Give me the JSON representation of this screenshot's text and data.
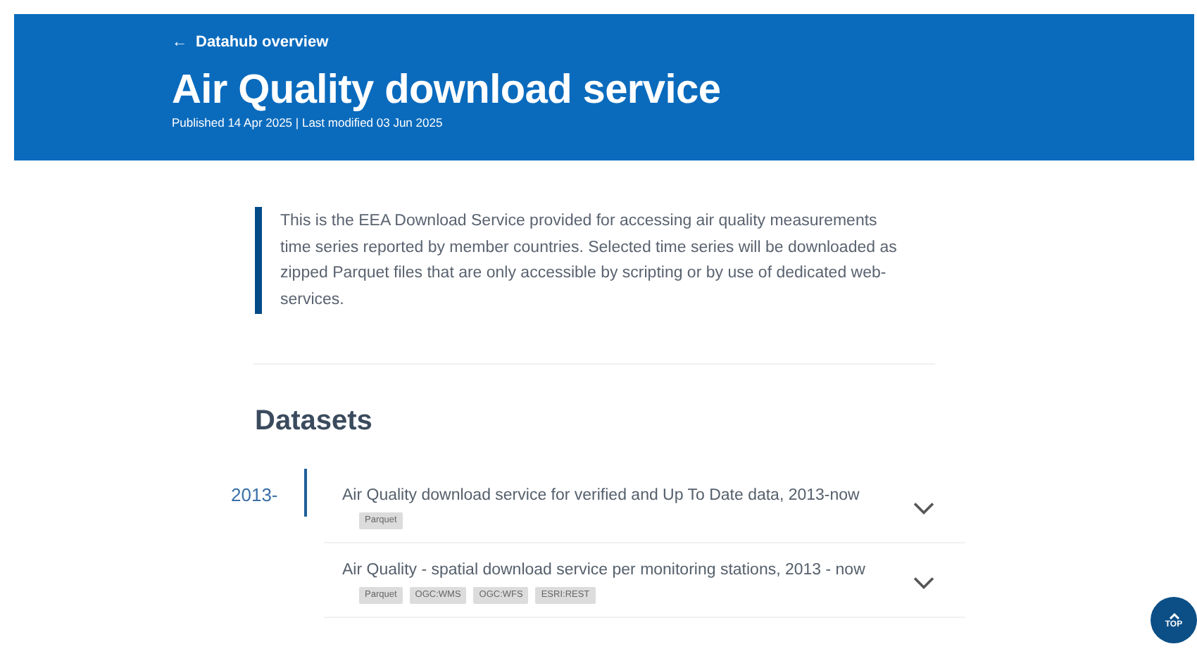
{
  "header": {
    "back_link": {
      "icon": "←",
      "label": "Datahub overview"
    },
    "title": "Air Quality download service",
    "meta": "Published 14 Apr 2025 | Last modified 03 Jun 2025"
  },
  "description": "This is the EEA Download Service provided for accessing air quality measurements time series reported by member countries. Selected time series will be downloaded as zipped Parquet files that are only accessible by scripting or by use of dedicated web-services.",
  "datasets": {
    "heading": "Datasets",
    "groups": [
      {
        "period": "2013-",
        "items": [
          {
            "title": "Air Quality download service for verified and Up To Date data, 2013-now",
            "tags": [
              "Parquet"
            ],
            "expanded": false
          },
          {
            "title": "Air Quality - spatial download service per monitoring stations, 2013 - now",
            "tags": [
              "Parquet",
              "OGC:WMS",
              "OGC:WFS",
              "ESRI:REST"
            ],
            "expanded": false
          }
        ]
      }
    ]
  },
  "top_button": {
    "label": "TOP"
  }
}
